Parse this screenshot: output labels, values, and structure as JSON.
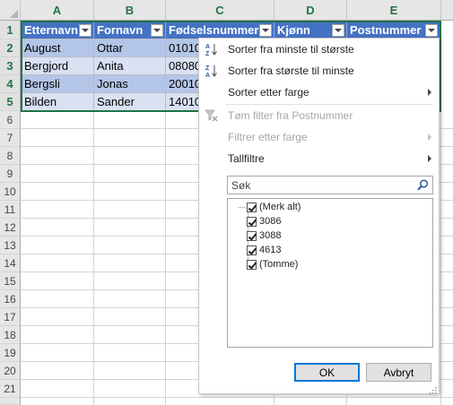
{
  "columns": [
    "A",
    "B",
    "C",
    "D",
    "E"
  ],
  "rows": [
    "1",
    "2",
    "3",
    "4",
    "5",
    "6",
    "7",
    "8",
    "9",
    "10",
    "11",
    "12",
    "13",
    "14",
    "15",
    "16",
    "17",
    "18",
    "19",
    "20",
    "21"
  ],
  "table": {
    "headers": [
      "Etternavn",
      "Fornavn",
      "Fødselsnummer",
      "Kjønn",
      "Postnummer"
    ],
    "data": [
      [
        "August",
        "Ottar",
        "01010"
      ],
      [
        "Bergjord",
        "Anita",
        "08080"
      ],
      [
        "Bergsli",
        "Jonas",
        "20010"
      ],
      [
        "Bilden",
        "Sander",
        "14010"
      ]
    ]
  },
  "menu": {
    "sort_asc": "Sorter fra minste til største",
    "sort_desc": "Sorter fra største til minste",
    "sort_color": "Sorter etter farge",
    "clear_filter": "Tøm filter fra Postnummer",
    "filter_color": "Filtrer etter farge",
    "number_filters": "Tallfiltre",
    "search_placeholder": "Søk",
    "items": [
      {
        "label": "(Merk alt)",
        "checked": true
      },
      {
        "label": "3086",
        "checked": true
      },
      {
        "label": "3088",
        "checked": true
      },
      {
        "label": "4613",
        "checked": true
      },
      {
        "label": "(Tomme)",
        "checked": true
      }
    ],
    "ok_label": "OK",
    "cancel_label": "Avbryt"
  },
  "colors": {
    "header_fill": "#4472c4",
    "band_fill": "#b4c6e7",
    "accent_green": "#217346"
  },
  "icons": {
    "sort_asc": "sort-ascending-icon",
    "sort_desc": "sort-descending-icon",
    "clear_filter": "clear-filter-icon",
    "search": "magnifier-icon"
  }
}
